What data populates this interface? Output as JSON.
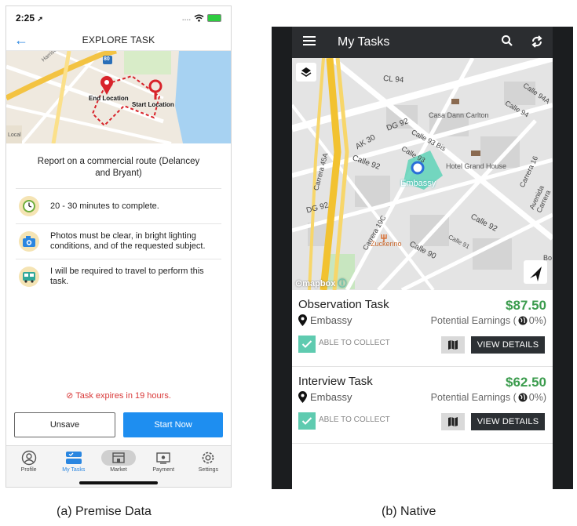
{
  "phone_a": {
    "status_bar": {
      "time": "2:25",
      "signal": "....",
      "battery_color": "#2ecc40"
    },
    "nav": {
      "title": "EXPLORE TASK"
    },
    "map": {
      "road_label": "Harrison St",
      "highway_label": "80",
      "end_label": "End Location",
      "start_label": "Start Location",
      "corner_label": "Local"
    },
    "report_title": "Report on a commercial route (Delancey and Bryant)",
    "requirements": [
      {
        "icon": "clock-icon",
        "text": "20 - 30 minutes to complete."
      },
      {
        "icon": "camera-icon",
        "text": "Photos must be clear, in bright lighting conditions, and of the requested subject."
      },
      {
        "icon": "bus-icon",
        "text": "I will be required to travel to perform this task."
      }
    ],
    "expiry_text": "Task expires in 19 hours.",
    "buttons": {
      "unsave": "Unsave",
      "start": "Start Now"
    },
    "tabs": [
      {
        "label": "Profile",
        "icon": "profile-icon"
      },
      {
        "label": "My Tasks",
        "icon": "tasks-icon",
        "active": true
      },
      {
        "label": "Market",
        "icon": "market-icon"
      },
      {
        "label": "Payment",
        "icon": "payment-icon"
      },
      {
        "label": "Settings",
        "icon": "settings-icon"
      }
    ],
    "colors": {
      "accent": "#1e8ef0",
      "expire": "#d93a3a"
    }
  },
  "phone_b": {
    "header": {
      "title": "My Tasks"
    },
    "map": {
      "streets": [
        "CL 94",
        "Calle 94A",
        "Calle 94",
        "DG 92",
        "AK 30",
        "Calle 93 Bis",
        "Calle 93",
        "Carrera 45A",
        "Calle 92",
        "DG 92",
        "Carrera 16",
        "Avenida Carrera",
        "Carrera 19C",
        "Calle 92",
        "Calle 91",
        "Calle 90",
        "Bo"
      ],
      "pois": [
        "Casa Dann Carlton",
        "Hotel Grand House",
        "Embassy",
        "Zuckerino"
      ],
      "attribution": "mapbox"
    },
    "tasks": [
      {
        "name": "Observation Task",
        "price": "$87.50",
        "location": "Embassy",
        "earnings": "Potential Earnings (",
        "earnings_pct": "0%)",
        "collect": "ABLE TO COLLECT",
        "details": "VIEW DETAILS"
      },
      {
        "name": "Interview Task",
        "price": "$62.50",
        "location": "Embassy",
        "earnings": "Potential Earnings (",
        "earnings_pct": "0%)",
        "collect": "ABLE TO COLLECT",
        "details": "VIEW DETAILS"
      }
    ],
    "colors": {
      "price": "#3c9c4e",
      "check": "#5fcbb0",
      "header": "#2b2d30"
    }
  },
  "captions": {
    "a": "(a) Premise Data",
    "b": "(b) Native"
  }
}
